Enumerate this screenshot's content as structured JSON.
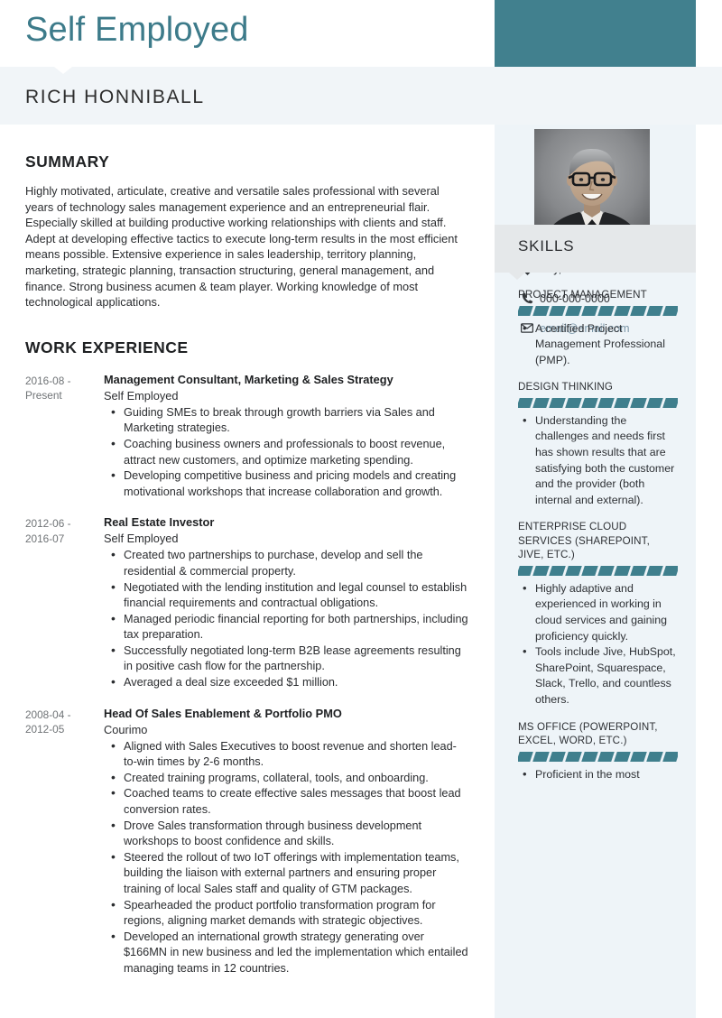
{
  "header": {
    "document_title": "Self Employed",
    "accent_color": "#41808e",
    "person_name": "RICH HONNIBALL"
  },
  "sidebar": {
    "photo_alt": "profile-photo",
    "contact": [
      {
        "icon": "location-pin-icon",
        "text": "City, State",
        "is_link": false
      },
      {
        "icon": "phone-icon",
        "text": "000-000-0000",
        "is_link": false
      },
      {
        "icon": "envelope-icon",
        "text": "email@email.com",
        "is_link": true
      }
    ],
    "skills_heading": "SKILLS",
    "skills": [
      {
        "name": "PROJECT MANAGEMENT",
        "segments": 10,
        "filled": 10,
        "bullets": [
          " A certified Project Management Professional (PMP)."
        ]
      },
      {
        "name": "DESIGN THINKING",
        "segments": 10,
        "filled": 10,
        "bullets": [
          "Understanding the challenges and needs first has shown results that are satisfying both the customer and the provider (both internal and external)."
        ]
      },
      {
        "name": "ENTERPRISE CLOUD SERVICES (SHAREPOINT, JIVE, ETC.)",
        "segments": 10,
        "filled": 10,
        "bullets": [
          "Highly adaptive and experienced in working in cloud services and gaining proficiency quickly.",
          "Tools include Jive, HubSpot, SharePoint, Squarespace, Slack, Trello, and countless others."
        ]
      },
      {
        "name": "MS OFFICE (POWERPOINT, EXCEL, WORD, ETC.)",
        "segments": 10,
        "filled": 10,
        "bullets": [
          "Proficient in the most"
        ]
      }
    ]
  },
  "main": {
    "summary_heading": "SUMMARY",
    "summary_text": "Highly motivated, articulate, creative and versatile sales professional with several years of technology sales management experience and an entrepreneurial flair. Especially skilled at building productive working relationships with clients and staff. Adept at developing effective tactics to execute long-term results in the most efficient means possible. Extensive experience in sales leadership, territory planning, marketing, strategic planning, transaction structuring, general management, and finance. Strong business acumen & team player. Working knowledge of most technological applications.",
    "work_heading": "WORK EXPERIENCE",
    "jobs": [
      {
        "dates": "2016-08 - Present",
        "title": "Management Consultant, Marketing & Sales Strategy",
        "company": "Self Employed",
        "bullets": [
          "Guiding SMEs to break through growth barriers via Sales and Marketing strategies.",
          "Coaching business owners and professionals to boost revenue, attract new customers, and optimize marketing spending.",
          "Developing competitive business and pricing models and creating motivational workshops that increase collaboration and growth."
        ]
      },
      {
        "dates": "2012-06 - 2016-07",
        "title": "Real Estate Investor",
        "company": "Self Employed",
        "bullets": [
          "Created two partnerships to purchase, develop and sell the residential & commercial property.",
          "Negotiated with the lending institution and legal counsel to establish financial requirements and contractual obligations.",
          "Managed periodic financial reporting for both partnerships, including tax preparation.",
          "Successfully negotiated long-term B2B lease agreements resulting in positive cash flow for the partnership.",
          "Averaged a deal size exceeded $1 million."
        ]
      },
      {
        "dates": "2008-04 - 2012-05",
        "title": "Head Of Sales Enablement & Portfolio PMO",
        "company": "Courimo",
        "bullets": [
          "Aligned with Sales Executives to boost revenue and shorten lead-to-win times by 2-6 months.",
          "Created training programs, collateral, tools, and onboarding.",
          "Coached teams to create effective sales messages that boost lead conversion rates.",
          "Drove Sales transformation through business development workshops to boost confidence and skills.",
          "Steered the rollout of two IoT offerings with implementation teams, building the liaison with external partners and ensuring proper training of local Sales staff and quality of GTM packages.",
          "Spearheaded the product portfolio transformation program for regions, aligning market demands with strategic objectives.",
          "Developed an international growth strategy generating over $166MN in new business and led the implementation which entailed managing teams in 12 countries."
        ]
      }
    ]
  }
}
